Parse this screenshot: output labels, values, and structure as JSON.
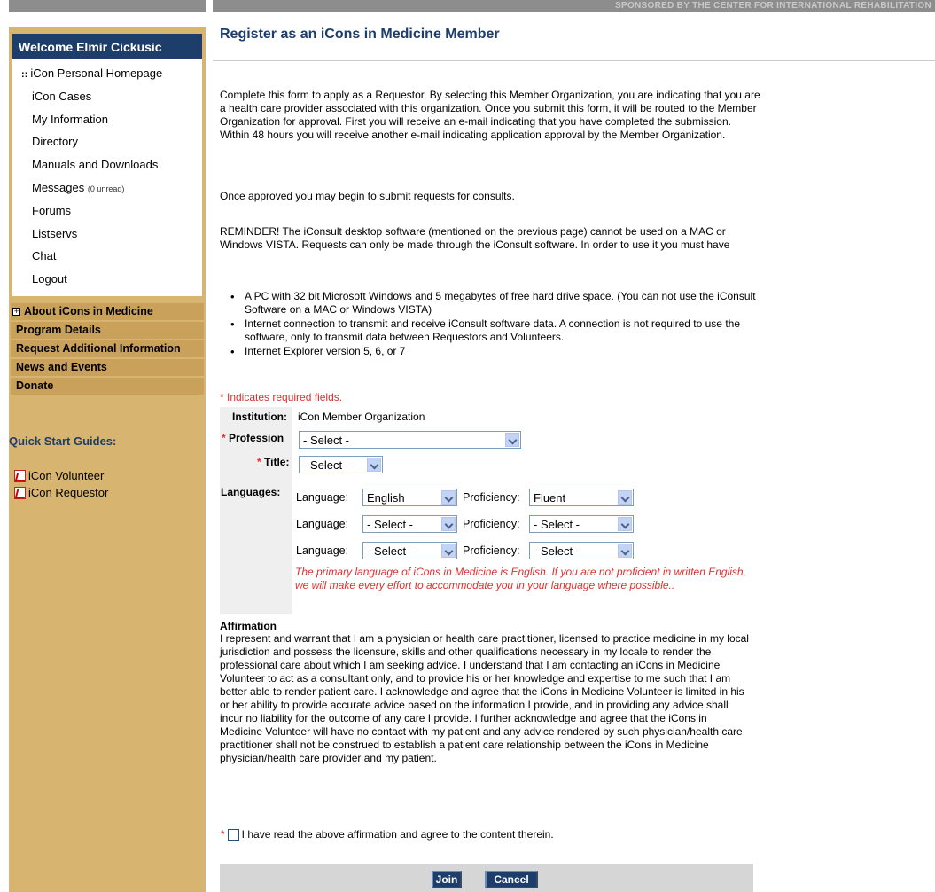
{
  "header": {
    "sponsor": "SPONSORED BY THE CENTER FOR INTERNATIONAL REHABILITATION"
  },
  "sidebar": {
    "welcome": "Welcome Elmir Cickusic",
    "menu": [
      {
        "label": "iCon Personal Homepage",
        "prefix": "::"
      },
      {
        "label": "iCon Cases"
      },
      {
        "label": "My Information"
      },
      {
        "label": "Directory"
      },
      {
        "label": "Manuals and Downloads"
      },
      {
        "label": "Messages",
        "suffix": "(0 unread)"
      },
      {
        "label": "Forums"
      },
      {
        "label": "Listservs"
      },
      {
        "label": "Chat"
      },
      {
        "label": "Logout"
      }
    ],
    "nav": [
      {
        "label": "About iCons in Medicine",
        "icon": "plus-box-icon"
      },
      {
        "label": "Program Details"
      },
      {
        "label": "Request Additional Information"
      },
      {
        "label": "News and Events"
      },
      {
        "label": "Donate"
      }
    ],
    "quick_start_title": "Quick Start Guides:",
    "guides": [
      {
        "label": "iCon Volunteer",
        "icon": "pdf-icon"
      },
      {
        "label": "iCon Requestor",
        "icon": "pdf-icon"
      }
    ]
  },
  "main": {
    "title": "Register as an iCons in Medicine Member",
    "intro": "Complete this form to apply as a Requestor.  By selecting this Member Organization, you are indicating that you are a health care provider associated with this organization. Once you submit this form, it will be routed to the Member Organization for approval. First you will receive an e-mail indicating that you have completed the submission. Within 48 hours you will receive another e-mail indicating application approval by the Member Organization.",
    "once_approved": "Once approved you may begin to submit requests for consults.",
    "reminder": "REMINDER! The iConsult desktop software (mentioned on the previous page) cannot be used on a MAC or Windows VISTA.  Requests can only be made through the iConsult software. In order to use it you must have",
    "requirements": [
      "A PC with 32 bit Microsoft Windows and 5 megabytes of free hard drive space. (You can not use the iConsult Software on a MAC or Windows VISTA)",
      "Internet connection to transmit and receive iConsult software data. A connection is not required to use the software, only to transmit data between Requestors and Volunteers.",
      "Internet Explorer version 5, 6, or 7"
    ],
    "required_note": "* Indicates required fields.",
    "form": {
      "institution_label": "Institution:",
      "institution_value": "iCon Member Organization",
      "profession_label": "Profession",
      "profession_value": "- Select -",
      "title_label": "Title:",
      "title_value": "- Select -",
      "languages_label": "Languages:",
      "language_label": "Language:",
      "proficiency_label": "Proficiency:",
      "languages": [
        {
          "language": "English",
          "proficiency": "Fluent"
        },
        {
          "language": "- Select -",
          "proficiency": "- Select -"
        },
        {
          "language": "- Select -",
          "proficiency": "- Select -"
        }
      ],
      "language_note": "The primary language of iCons in Medicine is English. If you are not proficient in written English, we will make every effort to accommodate you in your language where possible.."
    },
    "affirmation_title": "Affirmation",
    "affirmation_text": "I represent and warrant that I am a physician or health care practitioner, licensed to practice medicine in my local jurisdiction and possess the licensure, skills and other qualifications necessary in my locale to render the professional care about which I am seeking advice. I understand that I am contacting an iCons in Medicine Volunteer to act as a consultant only, and to provide his or her knowledge and expertise to me such that I am better able to render patient care. I acknowledge and agree that the iCons in Medicine Volunteer is limited in his or her ability to provide accurate advice based on the information I provide, and in providing any advice shall incur no liability for the outcome of any care I provide. I further acknowledge and agree that the iCons in Medicine Volunteer will have no contact with my patient and any advice rendered by such physician/health care practitioner shall not be construed to establish a patient care relationship between the iCons in Medicine physician/health care provider and my patient.",
    "agree_label": "I have read the above affirmation and agree to the content therein.",
    "join_label": "Join",
    "cancel_label": "Cancel"
  },
  "colors": {
    "navy": "#1d3d6b",
    "sidebar": "#d7b46f",
    "required_red": "#e03030"
  }
}
